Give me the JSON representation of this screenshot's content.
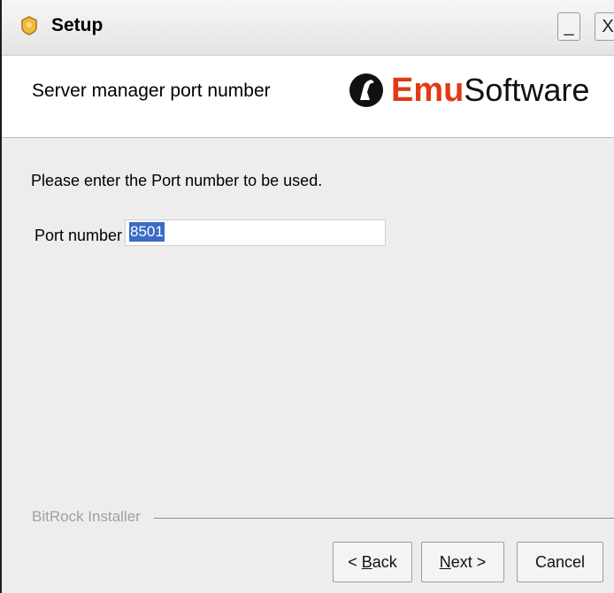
{
  "window": {
    "title": "Setup",
    "minimize_glyph": "_",
    "close_glyph": "X"
  },
  "header": {
    "title": "Server manager port number",
    "logo": {
      "emu": "Emu",
      "software": "Software"
    }
  },
  "content": {
    "prompt": "Please enter the Port number to be used.",
    "port_label": "Port number",
    "port_value": "8501"
  },
  "footer": {
    "installer_label": "BitRock Installer",
    "buttons": {
      "back_prefix": "< ",
      "back_mnemonic": "B",
      "back_rest": "ack",
      "next_mnemonic": "N",
      "next_rest": "ext >",
      "cancel": "Cancel"
    }
  },
  "colors": {
    "brand": "#e23a12",
    "selection": "#3a6bc6"
  },
  "icons": [
    "setup-app-icon",
    "emu-logo-icon"
  ]
}
